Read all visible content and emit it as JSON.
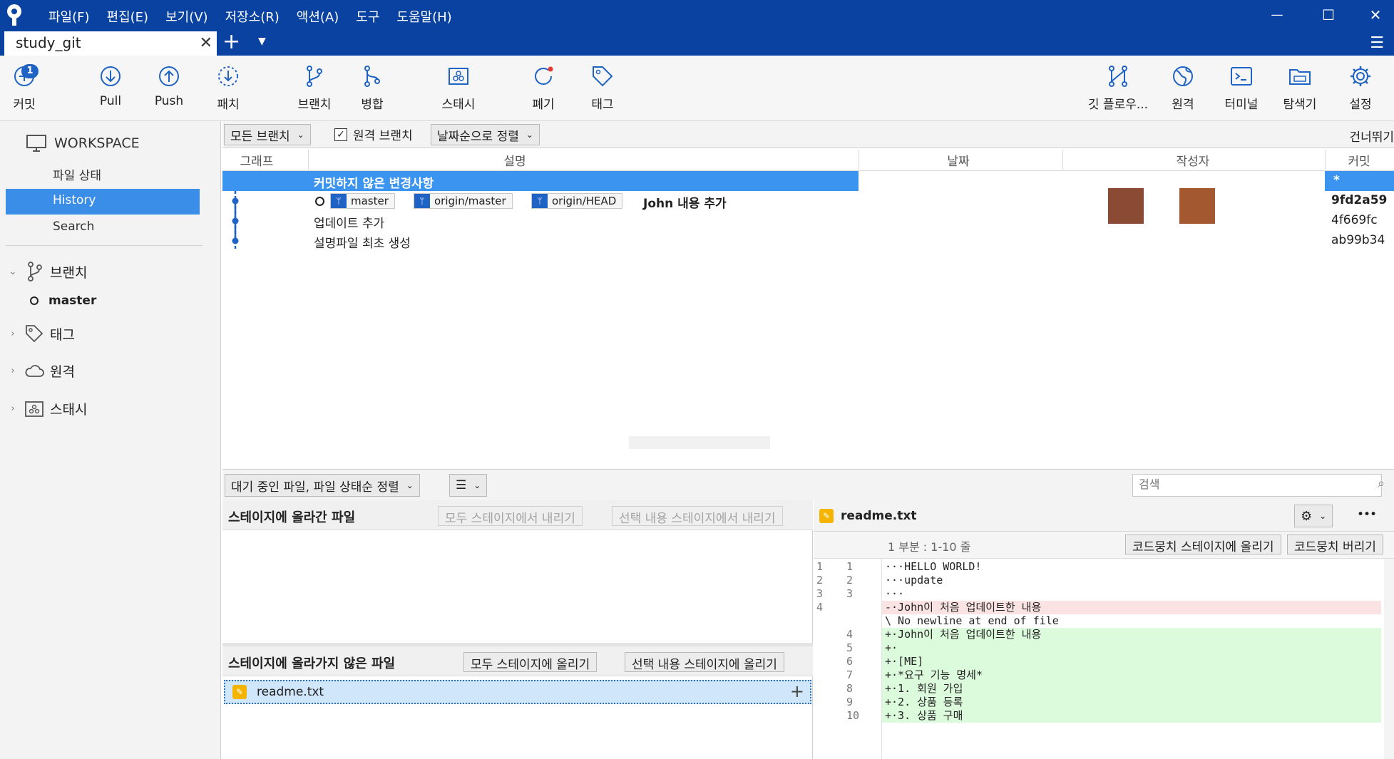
{
  "titlebar": {
    "menus": [
      "파일(F)",
      "편집(E)",
      "보기(V)",
      "저장소(R)",
      "액션(A)",
      "도구",
      "도움말(H)"
    ],
    "tab_label": "study_git",
    "tab_close": "✕",
    "tab_add": "+",
    "min": "—",
    "max": "☐",
    "close": "✕",
    "hamburger": "☰"
  },
  "toolbar": {
    "commit_badge": "1",
    "commit": "커밋",
    "pull": "Pull",
    "push": "Push",
    "patch": "패치",
    "branch": "브랜치",
    "merge": "병합",
    "stash": "스태시",
    "discard": "폐기",
    "tag": "태그",
    "gitflow": "깃 플로우...",
    "remote": "원격",
    "terminal": "터미널",
    "explorer": "탐색기",
    "settings": "설정"
  },
  "sidebar": {
    "workspace": "WORKSPACE",
    "file_status": "파일 상태",
    "history": "History",
    "search": "Search",
    "branches": "브랜치",
    "master": "master",
    "tags": "태그",
    "remotes": "원격",
    "stashes": "스태시"
  },
  "filterbar": {
    "branch_filter": "모든 브랜치",
    "remote_branches": "원격 브랜치",
    "sort": "날짜순으로 정렬",
    "skip": "건너뛰기"
  },
  "grid": {
    "headers": {
      "graph": "그래프",
      "description": "설명",
      "date": "날짜",
      "author": "작성자",
      "commit": "커밋"
    },
    "rows": [
      {
        "desc": "커밋하지 않은 변경사항",
        "hash": "*"
      },
      {
        "desc": "John 내용 추가",
        "hash": "9fd2a59",
        "refs": [
          "master",
          "origin/master",
          "origin/HEAD"
        ]
      },
      {
        "desc": "업데이트 추가",
        "hash": "4f669fc"
      },
      {
        "desc": "설명파일 최초 생성",
        "hash": "ab99b34"
      }
    ]
  },
  "lowerbar": {
    "pending_sort": "대기 중인 파일, 파일 상태순 정렬",
    "view_mode": "☰",
    "search_placeholder": "검색"
  },
  "staged": {
    "title": "스테이지에 올라간 파일",
    "unstage_all": "모두 스테이지에서 내리기",
    "unstage_selected": "선택 내용 스테이지에서 내리기"
  },
  "unstaged": {
    "title": "스테이지에 올라가지 않은 파일",
    "stage_all": "모두 스테이지에 올리기",
    "stage_selected": "선택 내용 스테이지에 올리기",
    "files": [
      {
        "name": "readme.txt",
        "action": "+"
      }
    ]
  },
  "diff": {
    "filename": "readme.txt",
    "more": "•••",
    "hunk_label": "1 부분 : 1-10 줄",
    "stage_hunk": "코드뭉치 스테이지에 올리기",
    "discard_hunk": "코드뭉치 버리기",
    "lines": [
      {
        "old": "1",
        "new": "1",
        "type": "ctx",
        "text": "···HELLO WORLD!"
      },
      {
        "old": "2",
        "new": "2",
        "type": "ctx",
        "text": "···update"
      },
      {
        "old": "3",
        "new": "3",
        "type": "ctx",
        "text": "···"
      },
      {
        "old": "4",
        "new": "",
        "type": "del",
        "text": "-·John이 처음 업데이트한 내용"
      },
      {
        "old": "",
        "new": "",
        "type": "ctx",
        "text": "\\ No newline at end of file"
      },
      {
        "old": "",
        "new": "4",
        "type": "add",
        "text": "+·John이 처음 업데이트한 내용"
      },
      {
        "old": "",
        "new": "5",
        "type": "add",
        "text": "+·"
      },
      {
        "old": "",
        "new": "6",
        "type": "add",
        "text": "+·[ME]"
      },
      {
        "old": "",
        "new": "7",
        "type": "add",
        "text": "+·*요구 기능 명세*"
      },
      {
        "old": "",
        "new": "8",
        "type": "add",
        "text": "+·1. 회원 가입"
      },
      {
        "old": "",
        "new": "9",
        "type": "add",
        "text": "+·2. 상품 등록"
      },
      {
        "old": "",
        "new": "10",
        "type": "add",
        "text": "+·3. 상품 구매"
      }
    ]
  },
  "colors": {
    "titlebar": "#0a42a2",
    "accent": "#1f63c4",
    "selection": "#3b94f0",
    "added_bg": "#dcfadc",
    "removed_bg": "#fbe3e3"
  }
}
